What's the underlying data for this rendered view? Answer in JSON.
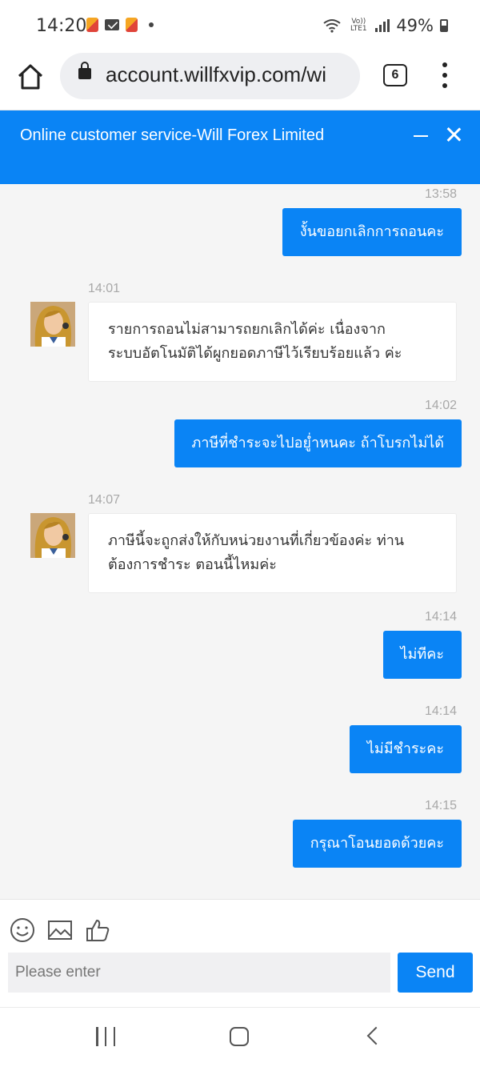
{
  "status_bar": {
    "time": "14:20",
    "network_label": "Vo)) LTE1",
    "battery_percent": "49%"
  },
  "browser": {
    "url": "account.willfxvip.com/wi",
    "tab_count": "6"
  },
  "chat": {
    "title": "Online customer service-Will Forex Limited",
    "messages": [
      {
        "time": "13:58",
        "side": "out",
        "text": "งั้นขอยกเลิกการถอนคะ"
      },
      {
        "time": "14:01",
        "side": "in",
        "lines": [
          "รายการถอนไม่สามารถยกเลิกได้ค่ะ เนื่องจาก",
          "ระบบอัตโนมัติได้ผูกยอดภาษีไว้เรียบร้อยแล้ว ค่ะ"
        ]
      },
      {
        "time": "14:02",
        "side": "out",
        "text": "ภาษีที่ชำระจะไปอยู่ำหนคะ ถ้าโบรกไม่ได้"
      },
      {
        "time": "14:07",
        "side": "in",
        "lines": [
          "ภาษีนี้จะถูกส่งให้กับหน่วยงานที่เกี่ยวข้องค่ะ ท่าน",
          "ต้องการชำระ ตอนนี้ไหมค่ะ"
        ]
      },
      {
        "time": "14:14",
        "side": "out",
        "text": "ไม่ทีคะ"
      },
      {
        "time": "14:14",
        "side": "out",
        "text": "ไม่มีชำระคะ"
      },
      {
        "time": "14:15",
        "side": "out",
        "text": "กรุณาโอนยอดด้วยคะ"
      }
    ]
  },
  "composer": {
    "placeholder": "Please enter",
    "value": "",
    "send_label": "Send"
  },
  "colors": {
    "accent": "#0a84f5",
    "chat_bg": "#f5f5f5"
  }
}
